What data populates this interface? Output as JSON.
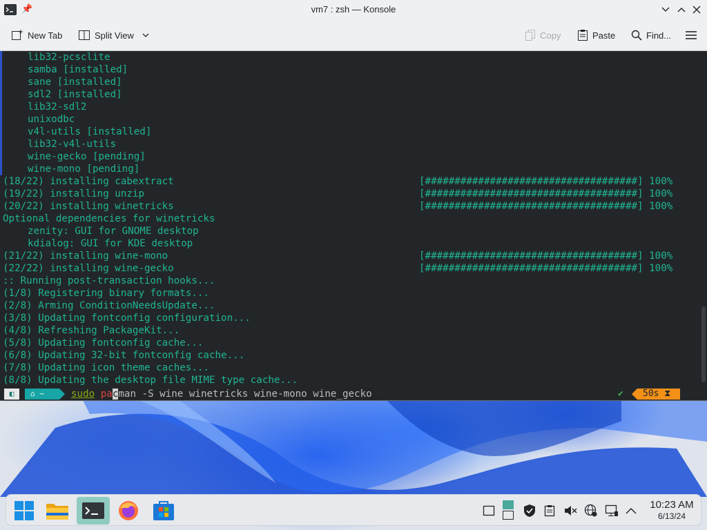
{
  "window": {
    "title": "vm7 : zsh — Konsole"
  },
  "toolbar": {
    "new_tab": "New Tab",
    "split_view": "Split View",
    "copy": "Copy",
    "paste": "Paste",
    "find": "Find..."
  },
  "terminal": {
    "lines": [
      "lib32-pcsclite",
      "samba [installed]",
      "sane [installed]",
      "sdl2 [installed]",
      "lib32-sdl2",
      "unixodbc",
      "v4l-utils [installed]",
      "lib32-v4l-utils",
      "wine-gecko [pending]",
      "wine-mono [pending]",
      "(18/22) installing cabextract",
      "(19/22) installing unzip",
      "(20/22) installing winetricks",
      "Optional dependencies for winetricks",
      "zenity: GUI for GNOME desktop",
      "kdialog: GUI for KDE desktop",
      "(21/22) installing wine-mono",
      "(22/22) installing wine-gecko",
      ":: Running post-transaction hooks...",
      "(1/8) Registering binary formats...",
      "(2/8) Arming ConditionNeedsUpdate...",
      "(3/8) Updating fontconfig configuration...",
      "(4/8) Refreshing PackageKit...",
      "(5/8) Updating fontconfig cache...",
      "(6/8) Updating 32-bit fontconfig cache...",
      "(7/8) Updating icon theme caches...",
      "(8/8) Updating the desktop file MIME type cache..."
    ],
    "progress_bar": "[####################################] 100%",
    "prompt": {
      "dir": "~",
      "cmd_sudo": "sudo",
      "cmd_pa": "pa",
      "cmd_cursor": "c",
      "cmd_rest": "man -S wine winetricks wine-mono wine_gecko",
      "status_ok": "✔",
      "duration": "50s ⧗"
    }
  },
  "taskbar": {
    "time": "10:23 AM",
    "date": "6/13/24"
  },
  "colors": {
    "terminal_bg": "#232629",
    "terminal_fg": "#1fb592",
    "chrome_bg": "#eff0f1",
    "active_task": "#8fcbc0",
    "duration_bg": "#f29018"
  }
}
